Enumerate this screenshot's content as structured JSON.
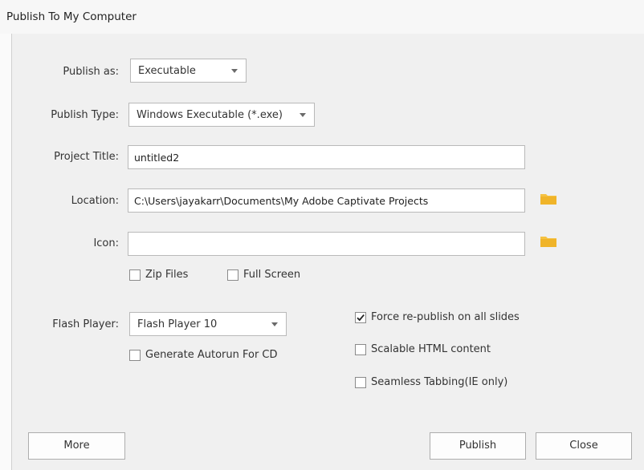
{
  "window": {
    "title": "Publish To My Computer"
  },
  "publish_as": {
    "label": "Publish as:",
    "value": "Executable"
  },
  "publish_type": {
    "label": "Publish Type:",
    "value": "Windows Executable (*.exe)"
  },
  "project_title": {
    "label": "Project Title:",
    "value": "untitled2"
  },
  "location": {
    "label": "Location:",
    "value": "C:\\Users\\jayakarr\\Documents\\My Adobe Captivate Projects"
  },
  "icon": {
    "label": "Icon:",
    "value": ""
  },
  "options": {
    "zip_files": {
      "label": "Zip Files",
      "checked": false
    },
    "full_screen": {
      "label": "Full Screen",
      "checked": false
    },
    "generate_autorun": {
      "label": "Generate Autorun For CD",
      "checked": false
    },
    "force_republish": {
      "label": "Force re-publish on all slides",
      "checked": true
    },
    "scalable_html": {
      "label": "Scalable HTML content",
      "checked": false
    },
    "seamless_tabbing": {
      "label": "Seamless Tabbing(IE only)",
      "checked": false
    }
  },
  "flash_player": {
    "label": "Flash Player:",
    "value": "Flash Player 10"
  },
  "buttons": {
    "more": "More",
    "publish": "Publish",
    "close": "Close"
  },
  "colors": {
    "folder": "#f5c242",
    "accent_border": "#b9b9b9"
  }
}
